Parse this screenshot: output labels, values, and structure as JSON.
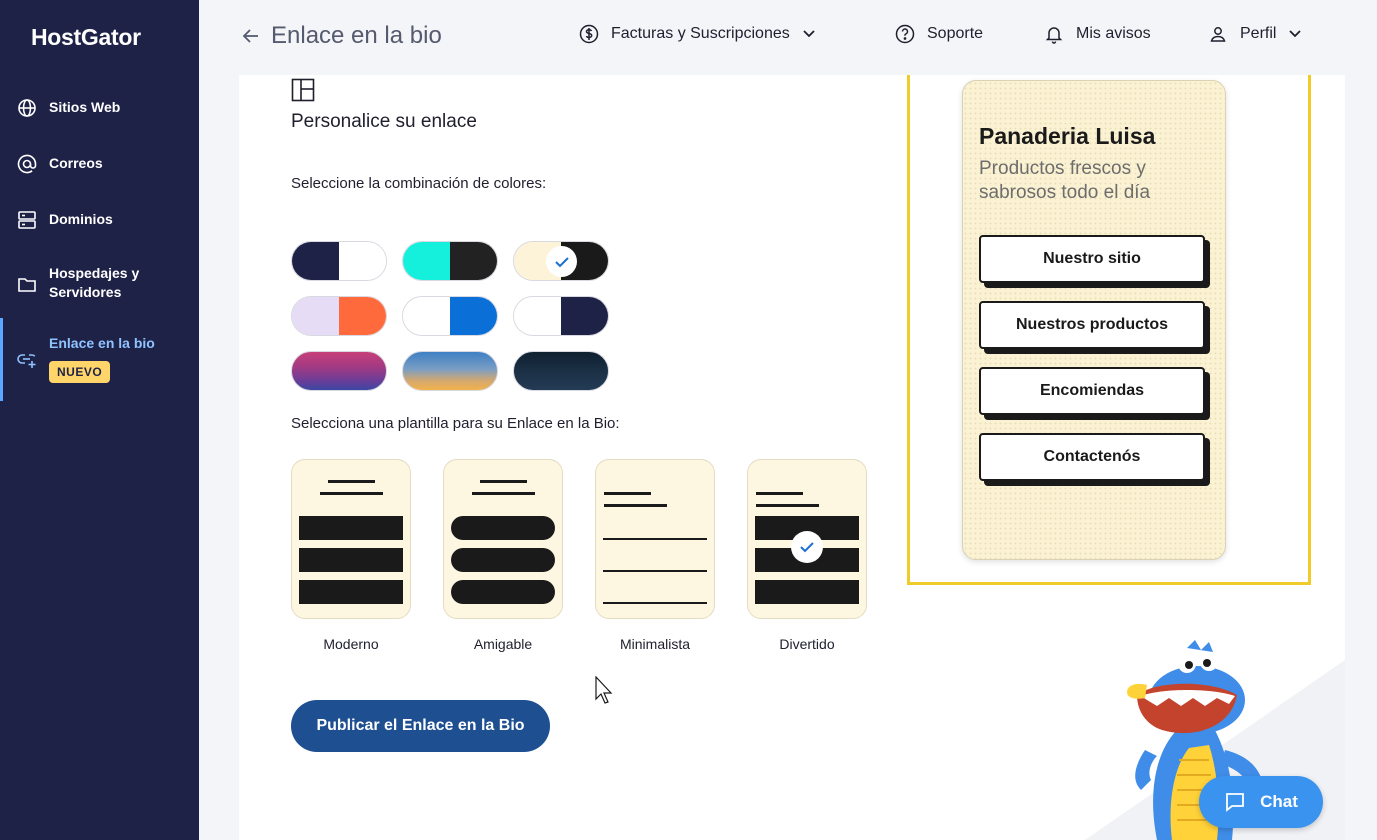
{
  "brand": {
    "name": "HostGator"
  },
  "sidebar": {
    "items": [
      {
        "label": "Sitios Web",
        "icon": "globe-icon"
      },
      {
        "label": "Correos",
        "icon": "at-icon"
      },
      {
        "label": "Dominios",
        "icon": "server-icon"
      },
      {
        "label": "Hospedajes y Servidores",
        "icon": "folder-icon"
      },
      {
        "label": "Enlace en la bio",
        "icon": "link-add-icon",
        "badge": "NUEVO",
        "active": true
      }
    ]
  },
  "header": {
    "title": "Enlace en la bio",
    "billing": "Facturas y Suscripciones",
    "support": "Soporte",
    "notices": "Mis avisos",
    "profile": "Perfil"
  },
  "main": {
    "section_title": "Personalice su enlace",
    "colors_label": "Seleccione la combinación de colores:",
    "templates_label": "Selecciona una plantilla para su Enlace en la Bio:",
    "color_schemes": [
      {
        "colors": [
          "#1e2247",
          "#ffffff"
        ],
        "selected": false
      },
      {
        "colors": [
          "#14f0dc",
          "#222222"
        ],
        "selected": false
      },
      {
        "colors": [
          "#fdf3d8",
          "#1a1a1a"
        ],
        "selected": true
      },
      {
        "colors": [
          "#e6dcf6",
          "#ff6a3d"
        ],
        "selected": false
      },
      {
        "colors": [
          "#ffffff",
          "#0a6fd6"
        ],
        "selected": false
      },
      {
        "colors": [
          "#ffffff",
          "#1e2247"
        ],
        "selected": false
      },
      {
        "gradient": [
          "#c73f7a",
          "#3c47a3"
        ],
        "selected": false
      },
      {
        "gradient": [
          "#3e7fc4",
          "#f2b24a"
        ],
        "selected": false
      },
      {
        "gradient": [
          "#0f2030",
          "#243b55"
        ],
        "selected": false
      }
    ],
    "templates": [
      {
        "name": "Moderno",
        "selected": false
      },
      {
        "name": "Amigable",
        "selected": false
      },
      {
        "name": "Minimalista",
        "selected": false
      },
      {
        "name": "Divertido",
        "selected": true
      }
    ],
    "publish_label": "Publicar el Enlace en la Bio"
  },
  "preview": {
    "business_name": "Panaderia Luisa",
    "description": "Productos frescos y sabrosos todo el día",
    "links": [
      "Nuestro sitio",
      "Nuestros productos",
      "Encomiendas",
      "Contactenós"
    ]
  },
  "chat": {
    "label": "Chat"
  },
  "colors": {
    "sidebar": "#1e2247",
    "accent": "#1d4f91",
    "highlight": "#f0cc2b",
    "chat": "#3b93f0"
  }
}
